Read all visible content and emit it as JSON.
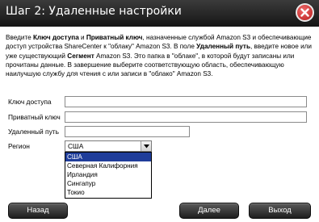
{
  "title": "Шаг 2: Удаленные настройки",
  "intro": {
    "p1": "Введите ",
    "b1": "Ключ доступа",
    "p2": " и ",
    "b2": "Приватный ключ",
    "p3": ", назначенные службой Amazon S3 и обеспечивающие доступ устройства ShareCenter к \"облаку\" Amazon S3. В поле ",
    "b3": "Удаленный путь",
    "p4": ", введите новое или уже существующий ",
    "b4": "Сегмент",
    "p5": " Amazon S3. Это папка в \"облаке\", в которой будут записаны или прочитаны данные. В завершение выберите соответствующую область, обеспечивающую наилучшую службу для чтения с или записи в \"облако\" Amazon S3."
  },
  "form": {
    "access_key_label": "Ключ доступа",
    "access_key_value": "",
    "private_key_label": "Приватный ключ",
    "private_key_value": "",
    "remote_path_label": "Удаленный путь",
    "remote_path_value": "",
    "region_label": "Регион",
    "region_selected": "США",
    "region_options": [
      "США",
      "Северная Калифорния",
      "Ирландия",
      "Сингапур",
      "Токио"
    ]
  },
  "buttons": {
    "back": "Назад",
    "next": "Далее",
    "exit": "Выход"
  },
  "colors": {
    "titlebar": "#2a2a2a",
    "close": "#c62828",
    "selection": "#1f3d9a"
  }
}
